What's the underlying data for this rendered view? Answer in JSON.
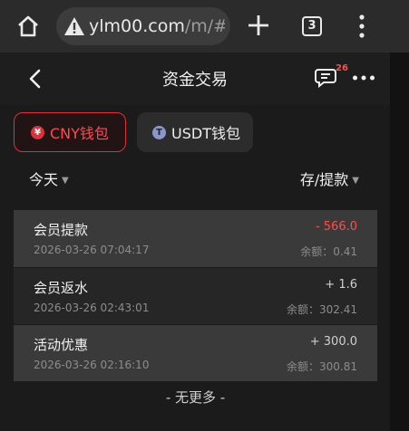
{
  "browser": {
    "url_domain": "ylm00.com",
    "url_path": "/m/#/r",
    "tab_count": "3",
    "icons": [
      "home-icon",
      "warning-icon",
      "plus-icon",
      "tabs-icon",
      "more-vert-icon"
    ]
  },
  "header": {
    "title": "资金交易",
    "badge_count": "26",
    "icons": [
      "back-icon",
      "message-icon",
      "more-horiz-icon"
    ]
  },
  "wallets": [
    {
      "label": "CNY钱包",
      "coin_symbol": "¥",
      "active": true
    },
    {
      "label": "USDT钱包",
      "coin_symbol": "T",
      "active": false
    }
  ],
  "filters": {
    "date": "今天",
    "type": "存/提款"
  },
  "transactions": [
    {
      "title": "会员提款",
      "time": "2026-03-26 07:04:17",
      "amount": "- 566.0",
      "balance": "余额：0.41"
    },
    {
      "title": "会员返水",
      "time": "2026-03-26 02:43:01",
      "amount": "+ 1.6",
      "balance": "余额：302.41"
    },
    {
      "title": "活动优惠",
      "time": "2026-03-26 02:16:10",
      "amount": "+ 300.0",
      "balance": "余额：300.81"
    }
  ],
  "footer": {
    "no_more": "- 无更多 -"
  },
  "colors": {
    "accent_red": "#e0303a",
    "background": "#1b1b1b"
  }
}
